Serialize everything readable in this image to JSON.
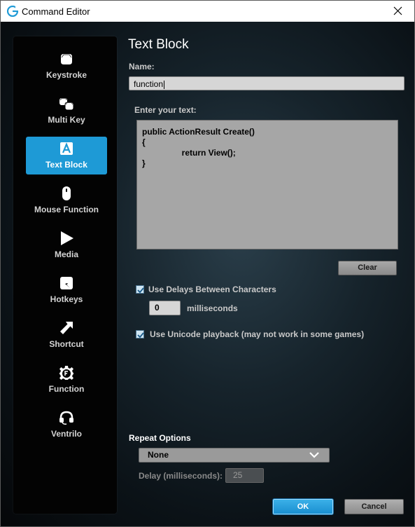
{
  "window": {
    "title": "Command Editor",
    "logo_icon": "logitech-g-icon",
    "accent_color": "#1e9ad6"
  },
  "sidebar": {
    "items": [
      {
        "label": "Keystroke",
        "icon": "keystroke-icon",
        "active": false
      },
      {
        "label": "Multi Key",
        "icon": "multi-key-icon",
        "active": false
      },
      {
        "label": "Text Block",
        "icon": "text-block-icon",
        "active": true
      },
      {
        "label": "Mouse Function",
        "icon": "mouse-icon",
        "active": false
      },
      {
        "label": "Media",
        "icon": "play-icon",
        "active": false
      },
      {
        "label": "Hotkeys",
        "icon": "hotkeys-icon",
        "active": false
      },
      {
        "label": "Shortcut",
        "icon": "shortcut-arrow-icon",
        "active": false
      },
      {
        "label": "Function",
        "icon": "function-gear-icon",
        "active": false
      },
      {
        "label": "Ventrilo",
        "icon": "headset-icon",
        "active": false
      }
    ]
  },
  "main": {
    "heading": "Text Block",
    "name_label": "Name:",
    "name_value": "function",
    "text_label": "Enter your text:",
    "text_lines": [
      "public ActionResult Create()",
      "{",
      "                 return View();",
      "}"
    ],
    "clear_label": "Clear",
    "use_delays": {
      "label": "Use Delays Between Characters",
      "checked": true
    },
    "delay_value": "0",
    "delay_unit": "milliseconds",
    "use_unicode": {
      "label": "Use Unicode playback (may not work in some games)",
      "checked": true
    }
  },
  "repeat": {
    "label": "Repeat Options",
    "selected": "None",
    "delay_label": "Delay (milliseconds):",
    "delay_value": "25"
  },
  "footer": {
    "ok_label": "OK",
    "cancel_label": "Cancel"
  }
}
